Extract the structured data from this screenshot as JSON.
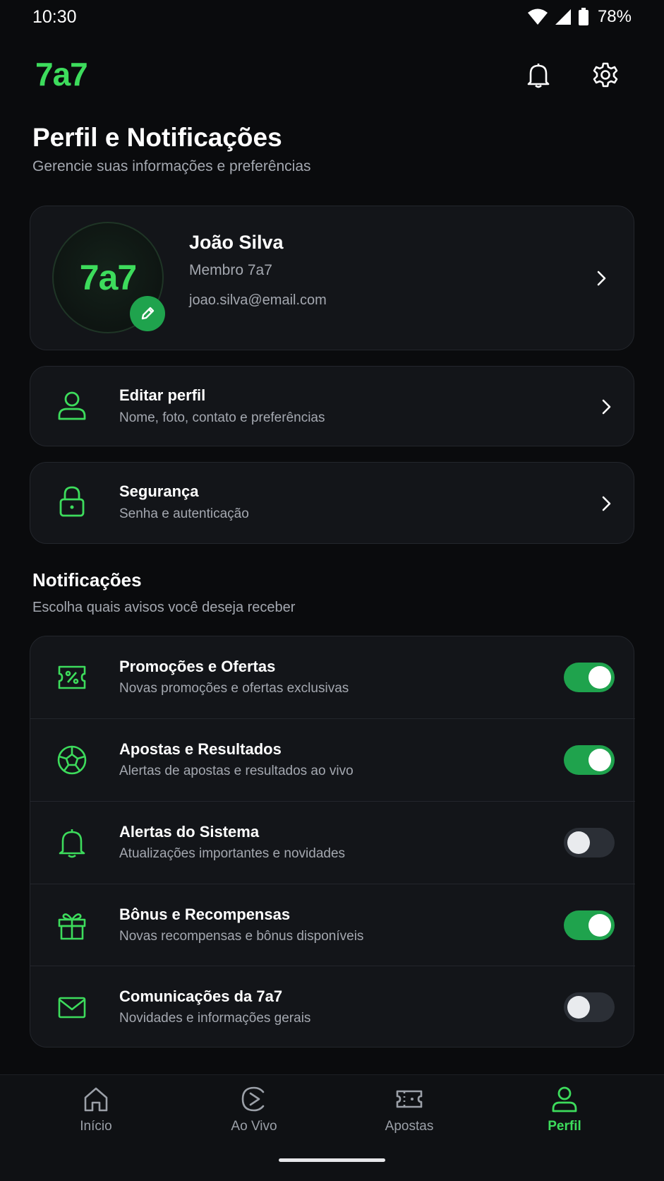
{
  "status_bar": {
    "time": "10:30",
    "battery": "78%"
  },
  "header": {
    "logo": "7a7"
  },
  "page": {
    "title": "Perfil e Notificações",
    "subtitle": "Gerencie suas informações e preferências"
  },
  "profile": {
    "avatar_logo": "7a7",
    "name": "João Silva",
    "member": "Membro 7a7",
    "email": "joao.silva@email.com"
  },
  "menu": [
    {
      "title": "Editar perfil",
      "subtitle": "Nome, foto, contato e preferências",
      "icon": "user-icon"
    },
    {
      "title": "Segurança",
      "subtitle": "Senha e autenticação",
      "icon": "lock-icon"
    }
  ],
  "notifications": {
    "title": "Notificações",
    "subtitle": "Escolha quais avisos você deseja receber",
    "items": [
      {
        "title": "Promoções e Ofertas",
        "subtitle": "Novas promoções e ofertas exclusivas",
        "icon": "percent-ticket-icon",
        "enabled": true
      },
      {
        "title": "Apostas e Resultados",
        "subtitle": "Alertas de apostas e resultados ao vivo",
        "icon": "soccer-ball-icon",
        "enabled": true
      },
      {
        "title": "Alertas do Sistema",
        "subtitle": "Atualizações importantes e novidades",
        "icon": "bell-icon",
        "enabled": false
      },
      {
        "title": "Bônus e Recompensas",
        "subtitle": "Novas recompensas e bônus disponíveis",
        "icon": "gift-icon",
        "enabled": true
      },
      {
        "title": "Comunicações da 7a7",
        "subtitle": "Novidades e informações gerais",
        "icon": "mail-icon",
        "enabled": false
      }
    ]
  },
  "bottom_nav": [
    {
      "label": "Início",
      "icon": "home-icon",
      "active": false
    },
    {
      "label": "Ao Vivo",
      "icon": "live-play-icon",
      "active": false
    },
    {
      "label": "Apostas",
      "icon": "ticket-icon",
      "active": false
    },
    {
      "label": "Perfil",
      "icon": "profile-icon",
      "active": true
    }
  ],
  "colors": {
    "accent": "#3ddc5c",
    "toggle_on": "#1fa34d",
    "background": "#0a0b0d",
    "card": "#131519"
  }
}
